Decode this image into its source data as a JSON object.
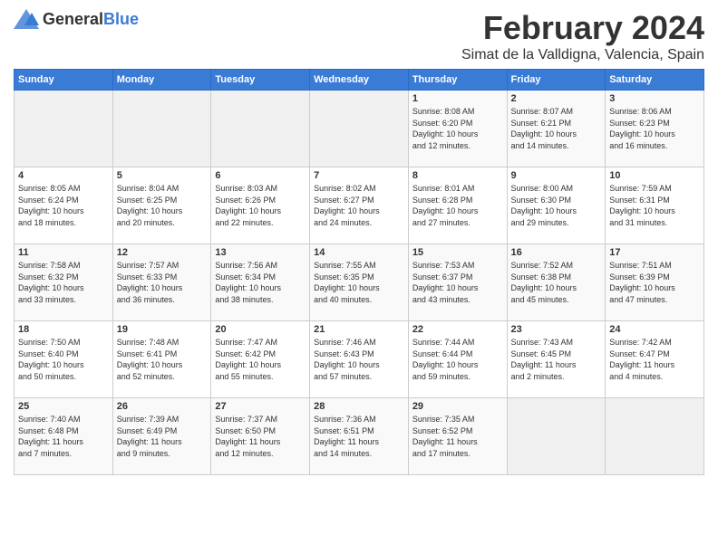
{
  "header": {
    "logo_general": "General",
    "logo_blue": "Blue",
    "title": "February 2024",
    "subtitle": "Simat de la Valldigna, Valencia, Spain"
  },
  "days_of_week": [
    "Sunday",
    "Monday",
    "Tuesday",
    "Wednesday",
    "Thursday",
    "Friday",
    "Saturday"
  ],
  "weeks": [
    [
      {
        "day": "",
        "info": ""
      },
      {
        "day": "",
        "info": ""
      },
      {
        "day": "",
        "info": ""
      },
      {
        "day": "",
        "info": ""
      },
      {
        "day": "1",
        "info": "Sunrise: 8:08 AM\nSunset: 6:20 PM\nDaylight: 10 hours\nand 12 minutes."
      },
      {
        "day": "2",
        "info": "Sunrise: 8:07 AM\nSunset: 6:21 PM\nDaylight: 10 hours\nand 14 minutes."
      },
      {
        "day": "3",
        "info": "Sunrise: 8:06 AM\nSunset: 6:23 PM\nDaylight: 10 hours\nand 16 minutes."
      }
    ],
    [
      {
        "day": "4",
        "info": "Sunrise: 8:05 AM\nSunset: 6:24 PM\nDaylight: 10 hours\nand 18 minutes."
      },
      {
        "day": "5",
        "info": "Sunrise: 8:04 AM\nSunset: 6:25 PM\nDaylight: 10 hours\nand 20 minutes."
      },
      {
        "day": "6",
        "info": "Sunrise: 8:03 AM\nSunset: 6:26 PM\nDaylight: 10 hours\nand 22 minutes."
      },
      {
        "day": "7",
        "info": "Sunrise: 8:02 AM\nSunset: 6:27 PM\nDaylight: 10 hours\nand 24 minutes."
      },
      {
        "day": "8",
        "info": "Sunrise: 8:01 AM\nSunset: 6:28 PM\nDaylight: 10 hours\nand 27 minutes."
      },
      {
        "day": "9",
        "info": "Sunrise: 8:00 AM\nSunset: 6:30 PM\nDaylight: 10 hours\nand 29 minutes."
      },
      {
        "day": "10",
        "info": "Sunrise: 7:59 AM\nSunset: 6:31 PM\nDaylight: 10 hours\nand 31 minutes."
      }
    ],
    [
      {
        "day": "11",
        "info": "Sunrise: 7:58 AM\nSunset: 6:32 PM\nDaylight: 10 hours\nand 33 minutes."
      },
      {
        "day": "12",
        "info": "Sunrise: 7:57 AM\nSunset: 6:33 PM\nDaylight: 10 hours\nand 36 minutes."
      },
      {
        "day": "13",
        "info": "Sunrise: 7:56 AM\nSunset: 6:34 PM\nDaylight: 10 hours\nand 38 minutes."
      },
      {
        "day": "14",
        "info": "Sunrise: 7:55 AM\nSunset: 6:35 PM\nDaylight: 10 hours\nand 40 minutes."
      },
      {
        "day": "15",
        "info": "Sunrise: 7:53 AM\nSunset: 6:37 PM\nDaylight: 10 hours\nand 43 minutes."
      },
      {
        "day": "16",
        "info": "Sunrise: 7:52 AM\nSunset: 6:38 PM\nDaylight: 10 hours\nand 45 minutes."
      },
      {
        "day": "17",
        "info": "Sunrise: 7:51 AM\nSunset: 6:39 PM\nDaylight: 10 hours\nand 47 minutes."
      }
    ],
    [
      {
        "day": "18",
        "info": "Sunrise: 7:50 AM\nSunset: 6:40 PM\nDaylight: 10 hours\nand 50 minutes."
      },
      {
        "day": "19",
        "info": "Sunrise: 7:48 AM\nSunset: 6:41 PM\nDaylight: 10 hours\nand 52 minutes."
      },
      {
        "day": "20",
        "info": "Sunrise: 7:47 AM\nSunset: 6:42 PM\nDaylight: 10 hours\nand 55 minutes."
      },
      {
        "day": "21",
        "info": "Sunrise: 7:46 AM\nSunset: 6:43 PM\nDaylight: 10 hours\nand 57 minutes."
      },
      {
        "day": "22",
        "info": "Sunrise: 7:44 AM\nSunset: 6:44 PM\nDaylight: 10 hours\nand 59 minutes."
      },
      {
        "day": "23",
        "info": "Sunrise: 7:43 AM\nSunset: 6:45 PM\nDaylight: 11 hours\nand 2 minutes."
      },
      {
        "day": "24",
        "info": "Sunrise: 7:42 AM\nSunset: 6:47 PM\nDaylight: 11 hours\nand 4 minutes."
      }
    ],
    [
      {
        "day": "25",
        "info": "Sunrise: 7:40 AM\nSunset: 6:48 PM\nDaylight: 11 hours\nand 7 minutes."
      },
      {
        "day": "26",
        "info": "Sunrise: 7:39 AM\nSunset: 6:49 PM\nDaylight: 11 hours\nand 9 minutes."
      },
      {
        "day": "27",
        "info": "Sunrise: 7:37 AM\nSunset: 6:50 PM\nDaylight: 11 hours\nand 12 minutes."
      },
      {
        "day": "28",
        "info": "Sunrise: 7:36 AM\nSunset: 6:51 PM\nDaylight: 11 hours\nand 14 minutes."
      },
      {
        "day": "29",
        "info": "Sunrise: 7:35 AM\nSunset: 6:52 PM\nDaylight: 11 hours\nand 17 minutes."
      },
      {
        "day": "",
        "info": ""
      },
      {
        "day": "",
        "info": ""
      }
    ]
  ]
}
